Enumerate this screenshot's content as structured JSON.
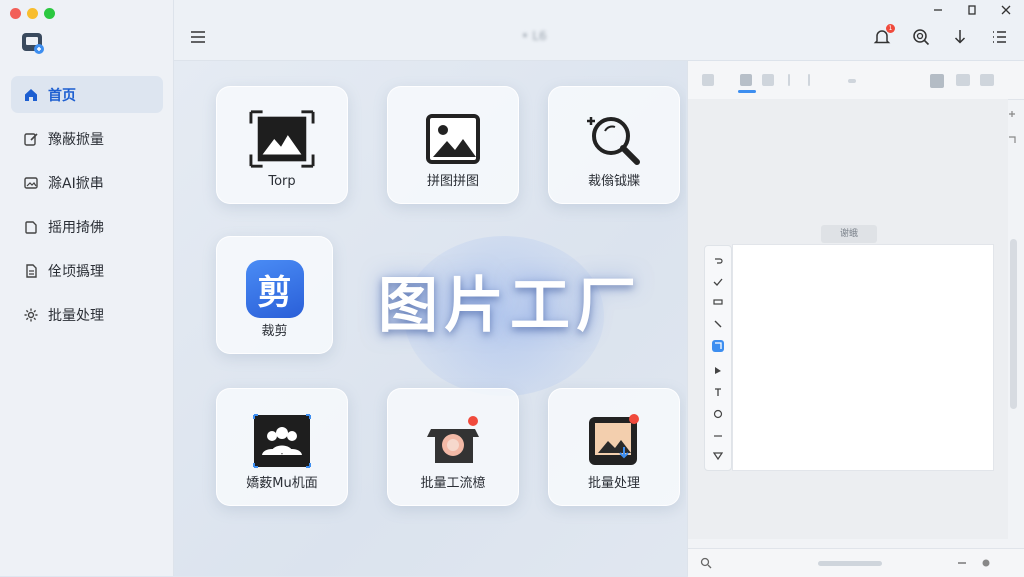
{
  "sidebar": {
    "items": [
      {
        "label": "首页",
        "icon": "home-icon",
        "active": true
      },
      {
        "label": "豫蔽掀量",
        "icon": "edit-icon"
      },
      {
        "label": "滁AI掀串",
        "icon": "image-ai-icon"
      },
      {
        "label": "摇用掎佛",
        "icon": "clip-icon"
      },
      {
        "label": "佺顷撝理",
        "icon": "document-icon"
      },
      {
        "label": "批量处理",
        "icon": "gear-icon"
      }
    ]
  },
  "topbar": {
    "title": "• L6",
    "notification_count": "1"
  },
  "main": {
    "hero_text": "图片工厂",
    "tiles": [
      {
        "label": "Torp",
        "icon": "image-frame-icon"
      },
      {
        "label": "拼图拼图",
        "icon": "picture-icon"
      },
      {
        "label": "裁傟钺牃",
        "icon": "magnify-icon"
      },
      {
        "label": "裁剪",
        "icon": "crop-jian-icon",
        "glyph": "剪"
      },
      {
        "label": "嬌薮Mu机面",
        "icon": "people-icon"
      },
      {
        "label": "批量工流檍",
        "icon": "camera-icon"
      },
      {
        "label": "批量处理",
        "icon": "image-download-icon"
      }
    ]
  },
  "panel": {
    "canvas_label": "谢蛾"
  },
  "colors": {
    "accent": "#1d5fd1",
    "tool_selected": "#3d8ef0",
    "badge": "#f04a3c"
  }
}
